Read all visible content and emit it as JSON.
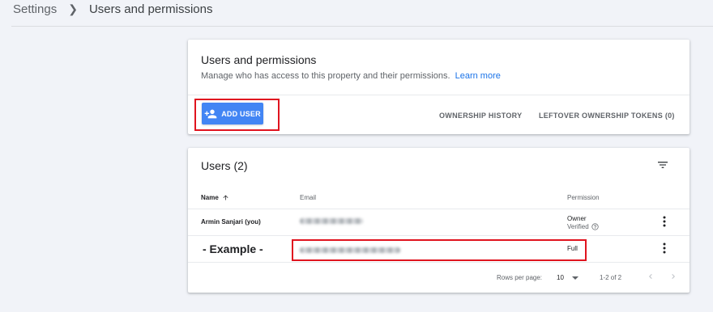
{
  "breadcrumb": {
    "root": "Settings",
    "current": "Users and permissions"
  },
  "permissions_card": {
    "title": "Users and permissions",
    "subtitle": "Manage who has access to this property and their permissions.",
    "learn_more": "Learn more",
    "add_user_label": "ADD USER",
    "ownership_history_label": "OWNERSHIP HISTORY",
    "leftover_tokens_label": "LEFTOVER OWNERSHIP TOKENS (0)"
  },
  "users_card": {
    "title": "Users (2)",
    "columns": {
      "name": "Name",
      "email": "Email",
      "permission": "Permission"
    },
    "rows": [
      {
        "name": "Armin Sanjari (you)",
        "email": "",
        "permission": "Owner",
        "status": "Verified"
      },
      {
        "name": "- Example -",
        "email": "",
        "permission": "Full"
      }
    ],
    "pagination": {
      "rows_per_page_label": "Rows per page:",
      "rows_per_page_value": "10",
      "range": "1-2 of 2"
    }
  },
  "colors": {
    "accent": "#4285f4",
    "highlight": "#e0141f",
    "link": "#1a73e8"
  },
  "icons": {
    "add_user": "person-add-icon",
    "filter": "filter-icon",
    "sort": "arrow-up-icon",
    "help": "help-circle-icon",
    "more": "more-vert-icon",
    "prev": "chevron-left-icon",
    "next": "chevron-right-icon"
  }
}
